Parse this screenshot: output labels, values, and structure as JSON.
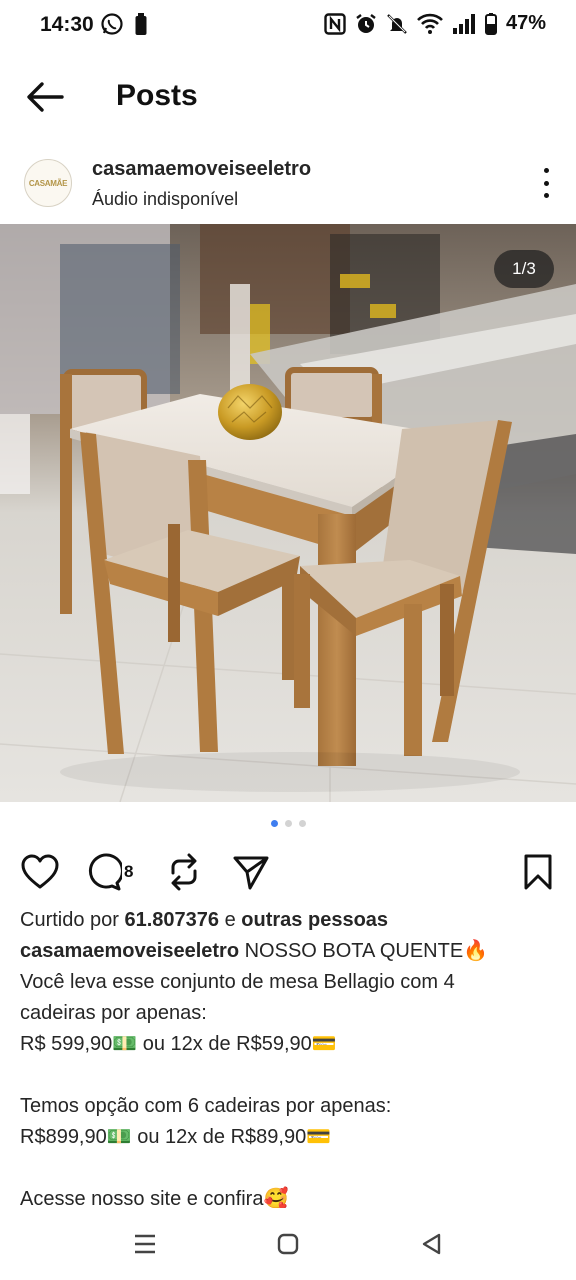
{
  "status_bar": {
    "time": "14:30",
    "battery": "47%"
  },
  "header": {
    "title": "Posts"
  },
  "post": {
    "username": "casamaemoveiseeletro",
    "audio_status": "Áudio indisponível",
    "avatar_text": "CASAMÃE",
    "media_counter": "1/3",
    "carousel_dots": 3,
    "carousel_active": 0,
    "comment_count": "8",
    "likes": {
      "prefix": "Curtido por ",
      "count": "61.807376",
      "middle": " e ",
      "suffix": "outras pessoas"
    },
    "caption": {
      "username": "casamaemoveiseeletro",
      "line1_text": " NOSSO BOTA QUENTE🔥",
      "line2": "Você leva esse conjunto de mesa Bellagio com 4",
      "line3": "cadeiras por apenas:",
      "line4": "R$ 599,90💵 ou 12x de R$59,90💳",
      "line6": "Temos opção com 6 cadeiras por apenas:",
      "line7": "R$899,90💵 ou 12x de R$89,90💳",
      "line9": "Acesse nosso site e confira🥰"
    }
  },
  "icons": {
    "back": "arrow-left-icon",
    "more": "more-vertical-icon",
    "like": "heart-icon",
    "comment": "comment-icon",
    "repost": "repost-icon",
    "share": "send-icon",
    "save": "bookmark-icon"
  },
  "colors": {
    "active_dot": "#3f7ef0",
    "text": "#262626"
  }
}
